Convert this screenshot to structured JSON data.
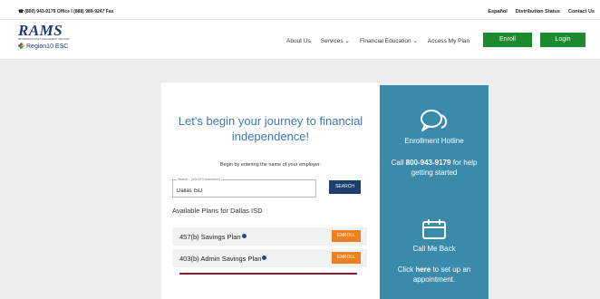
{
  "topbar": {
    "phone_text": "(800) 943-9179 Office I (888) 989-9247 Fax",
    "links": [
      "Español",
      "Distribution Status",
      "Contact Us"
    ]
  },
  "logo": {
    "name": "RAMS",
    "tagline": "RETIREMENT ASSET MANAGEMENT SERVICES",
    "region": "Region10 ESC"
  },
  "nav": {
    "items": [
      "About Us",
      "Services ⌄",
      "Financial Education ⌄",
      "Access My Plan"
    ],
    "enroll_label": "Enroll",
    "login_label": "Login"
  },
  "card": {
    "heading": "Let's begin your journey to financial independence!",
    "subtext": "Begin by entering the name of your employer:",
    "search": {
      "label": "Search... (min of 3 characters)",
      "value": "Dallas ISD",
      "button_label": "SEARCH"
    },
    "available_title": "Available Plans for Dallas ISD",
    "plans": [
      {
        "name": "457(b) Savings Plan",
        "enroll_label": "ENROLL"
      },
      {
        "name": "403(b) Admin Savings Plan",
        "enroll_label": "ENROLL"
      }
    ]
  },
  "side": {
    "hotline_title": "Enrollment Hotline",
    "call_prefix": "Call ",
    "call_number": "800-943-9179",
    "call_suffix": " for help getting started",
    "callback_title": "Call Me Back",
    "click_prefix": "Click ",
    "click_link": "here",
    "click_suffix": " to set up an appointment."
  },
  "colors": {
    "brand_blue": "#3b78b8",
    "panel_blue": "#3a8aab",
    "green": "#1c8a2e",
    "orange": "#f07f1f",
    "navy": "#1d3f6e"
  }
}
